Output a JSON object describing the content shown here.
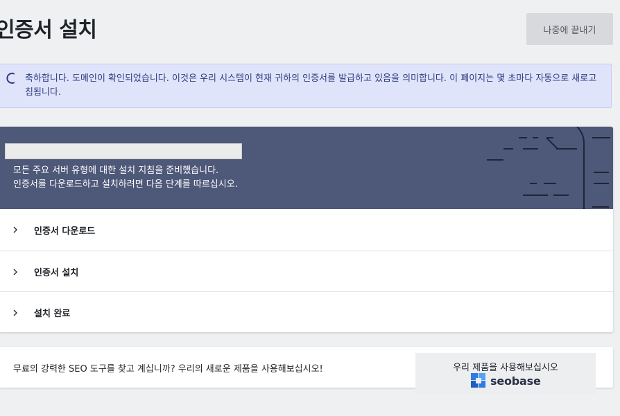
{
  "page": {
    "title": "인증서 설치",
    "later_button": "나중에 끝내기"
  },
  "banner": {
    "text": "축하합니다. 도메인이 확인되었습니다. 이것은 우리 시스템이 현재 귀하의 인증서를 발급하고 있음을 의미합니다. 이 페이지는 몇 초마다 자동으로 새로고침됩니다.",
    "icon": "spinner-icon"
  },
  "card": {
    "header_line1": "모든 주요 서버 유형에 대한 설치 지침을 준비했습니다.",
    "header_line2": "인증서를 다운로드하고 설치하려면 다음 단계를 따르십시오.",
    "steps": [
      {
        "label": "인증서 다운로드",
        "icon": "chevron-right-icon"
      },
      {
        "label": "인증서 설치",
        "icon": "chevron-right-icon"
      },
      {
        "label": "설치 완료",
        "icon": "chevron-right-icon"
      }
    ]
  },
  "promo": {
    "text": "무료의 강력한 SEO 도구를 찾고 계십니까? 우리의 새로운 제품을 사용해보십시오!",
    "button_label": "우리 제품을 사용해보십시오",
    "logo_text": "seobase",
    "logo_icon": "seobase-logo-icon"
  },
  "colors": {
    "header_bg": "#4e5878",
    "banner_bg": "#e0e4fb",
    "banner_text": "#2b3a7c",
    "logo_blue": "#2f7be0"
  }
}
